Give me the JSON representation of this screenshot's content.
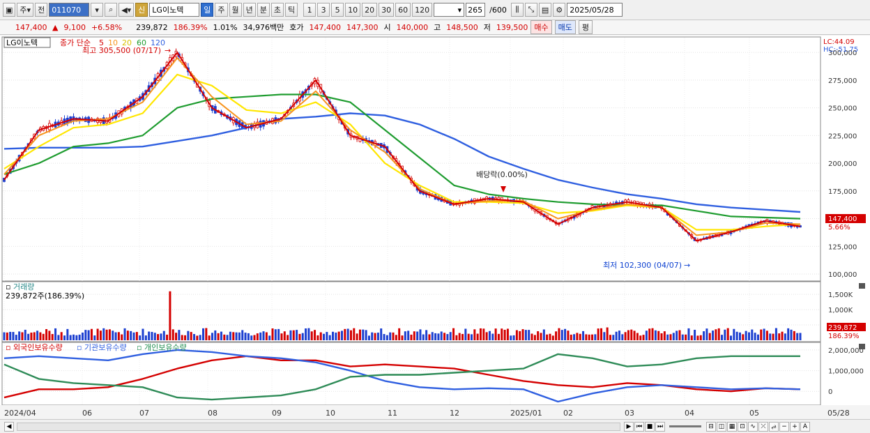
{
  "toolbar": {
    "period_label": "주",
    "prev_label": "전",
    "code_value": "011070",
    "new_badge": "신",
    "stock_name": "LG이노텍",
    "tf_day": "일",
    "tf_week": "주",
    "tf_month": "월",
    "tf_year": "년",
    "tf_min": "분",
    "tf_sec": "초",
    "tf_tick": "틱",
    "intervals": [
      "1",
      "3",
      "5",
      "10",
      "20",
      "30",
      "60",
      "120"
    ],
    "count_value": "265",
    "count_total": "/600",
    "date_value": "2025/05/28"
  },
  "quote": {
    "price": "147,400",
    "change": "9,100",
    "change_pct": "+6.58%",
    "volume": "239,872",
    "volume_pct": "186.39%",
    "turnover_pct": "1.01%",
    "amount": "34,976백만",
    "bid_label": "호가",
    "ask_price": "147,400",
    "bid_price": "147,300",
    "open_label": "시",
    "open": "140,000",
    "high_label": "고",
    "high": "148,500",
    "low_label": "저",
    "low": "139,500",
    "buy_label": "매수",
    "sell_label": "매도",
    "eval_label": "평"
  },
  "legend": {
    "stock": "LG이노텍",
    "ma_title": "종가 단순",
    "ma_periods": [
      "5",
      "10",
      "20",
      "60",
      "120"
    ],
    "high_annot": "최고 305,500 (07/17)",
    "low_annot": "최저 102,300 (04/07)",
    "dividend_annot": "배당락(0.00%)",
    "lc": "LC:44.09",
    "hc": "HC:-51.75",
    "last_price": "147,400",
    "last_pct": "5.66%"
  },
  "volume_panel": {
    "title": "거래량",
    "value": "239,872주(186.39%)",
    "last_value": "239,872",
    "last_pct": "186.39%"
  },
  "holdings_panel": {
    "foreign": "외국인보유수량",
    "institution": "기관보유수량",
    "individual": "개인보유수량"
  },
  "colors": {
    "ma5": "#d40000",
    "ma10": "#f7941d",
    "ma20": "#ffe600",
    "ma60": "#1e9c2f",
    "ma120": "#2f5fe0",
    "up": "#d40000",
    "down": "#1c3fd0"
  },
  "chart_data": {
    "type": "line",
    "title": "LG이노텍",
    "price_axis": [
      "300,000",
      "275,000",
      "250,000",
      "225,000",
      "200,000",
      "175,000",
      "150,000",
      "125,000",
      "100,000"
    ],
    "price_ylim": [
      95000,
      312000
    ],
    "volume_axis": [
      "1,500K",
      "1,000K",
      "500K"
    ],
    "holdings_axis": [
      "2,000,000",
      "1,000,000",
      "0"
    ],
    "x_labels": [
      "2024/04",
      "06",
      "07",
      "08",
      "09",
      "10",
      "11",
      "12",
      "2025/01",
      "02",
      "03",
      "04",
      "05",
      "05/28"
    ],
    "series": [
      {
        "name": "5",
        "values": [
          185000,
          230000,
          240000,
          238000,
          260000,
          300000,
          250000,
          232000,
          240000,
          275000,
          225000,
          215000,
          175000,
          163000,
          168000,
          165000,
          145000,
          160000,
          165000,
          160000,
          130000,
          138000,
          148000,
          143000
        ]
      },
      {
        "name": "10",
        "values": [
          190000,
          225000,
          238000,
          240000,
          255000,
          295000,
          260000,
          235000,
          238000,
          265000,
          230000,
          210000,
          177000,
          163000,
          166000,
          166000,
          150000,
          158000,
          163000,
          160000,
          135000,
          138000,
          146000,
          145000
        ]
      },
      {
        "name": "20",
        "values": [
          195000,
          215000,
          232000,
          235000,
          245000,
          280000,
          270000,
          248000,
          245000,
          255000,
          235000,
          200000,
          180000,
          165000,
          165000,
          164000,
          155000,
          157000,
          162000,
          160000,
          140000,
          140000,
          143000,
          145000
        ]
      },
      {
        "name": "60",
        "values": [
          190000,
          200000,
          215000,
          218000,
          225000,
          250000,
          258000,
          260000,
          262000,
          262000,
          255000,
          230000,
          205000,
          180000,
          172000,
          168000,
          165000,
          163000,
          162000,
          162000,
          157000,
          152000,
          151000,
          150000
        ]
      },
      {
        "name": "120",
        "values": [
          213000,
          214000,
          214000,
          214000,
          215000,
          220000,
          225000,
          232000,
          240000,
          242000,
          245000,
          243000,
          235000,
          222000,
          206000,
          195000,
          185000,
          178000,
          172000,
          168000,
          163000,
          160000,
          158000,
          156000
        ]
      }
    ]
  }
}
